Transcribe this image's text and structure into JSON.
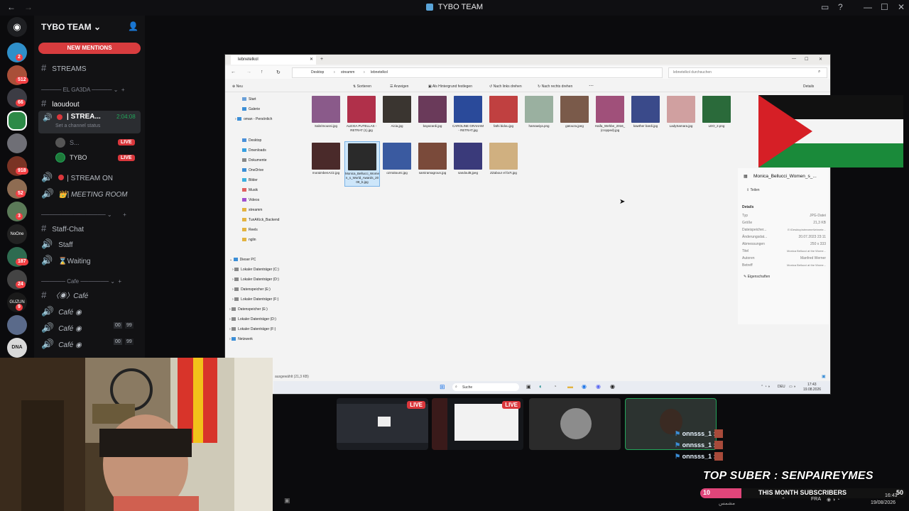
{
  "window": {
    "title": "TYBO TEAM"
  },
  "server": {
    "name": "TYBO TEAM",
    "new_mentions": "NEW MENTIONS",
    "badges": [
      "2",
      "512",
      "66",
      "918",
      "52",
      "3",
      "187",
      "24",
      "9"
    ],
    "rail_labels": [
      "NoOne",
      "GUZUN",
      "DNA"
    ]
  },
  "channels": {
    "streams": "STREAMS",
    "cat_ga3da": "EL GA3DA",
    "laoudout": "laoudout",
    "stream_live": "| STREA...",
    "stream_timer": "2:04:08",
    "channel_status": "Set a channel status",
    "voice_user_1": "S...",
    "voice_user_2": "TYBO",
    "live_label": "LIVE",
    "stream_on": "| STREAM ON",
    "meeting_room": "| MEETING ROOM",
    "staff_chat": "Staff-Chat",
    "staff": "Staff",
    "waiting": "Waiting",
    "cat_cafe": "Cafe",
    "cafe_text": "Café",
    "cafe_voice_1": "Café",
    "cafe_voice_2": "Café",
    "cafe_voice_3": "Café",
    "count_00": "00",
    "count_99": "99"
  },
  "explorer": {
    "tab": "lebnetelkol",
    "breadcrumb": [
      "Desktop",
      "streamm",
      "lebnetelkol"
    ],
    "search_placeholder": "lebnetelkol durchsuchen",
    "toolbar": [
      "Neu",
      "Sortieren",
      "Anzeigen",
      "Als Hintergrund festlegen",
      "Nach links drehen",
      "Nach rechts drehen",
      "Details"
    ],
    "nav": [
      "Start",
      "Galerie",
      "oman - Persönlich",
      "Desktop",
      "Downloads",
      "Dokumente",
      "OneDrive",
      "Bilder",
      "Musik",
      "Videos",
      "streamm",
      "TunAKick_Backend",
      "Reels",
      "nglin",
      "Dieser PC",
      "Lokaler Datenträger (C:)",
      "Lokaler Datenträger (D:)",
      "Datenspeicher (E:)",
      "Lokaler Datenträger (F:)",
      "Datenspeicher (E:)",
      "Lokaler Datenträger (D:)",
      "Lokaler Datenträger (F:)",
      "Netzwerk"
    ],
    "files_row1": [
      "Sabrimoussi.jpg",
      "ALEXIA PUTELLAS - RETRAT (1).jpg",
      "Aicia.jpg",
      "bayazardi.jpg",
      "CAROLINE GRAHAM - RETRAT.jpg",
      "fathi bidou.jpg",
      "hamawiya.png",
      "gatouza.jpeg",
      "Haifa_Wehbe_2016_(cropped).jpg",
      "kawther bardi.jpg",
      "LadySamara.jpg",
      "LEO_2.png"
    ],
    "files_row2": [
      "moraimbenAziz.jpg",
      "Monica_Bellucci_Women_s_World_Awards_2009_b.jpg",
      "ozrraitoumi.jpg",
      "samiramagroun.jpg",
      "sandoul8.jpeg",
      "ZZabour el fa7t.jpg"
    ],
    "details_title": "Monica_Bellucci_Women_s_...",
    "share": "Teilen",
    "details_heading": "Details",
    "detail_keys": [
      "Typ",
      "Größe",
      "Dateispeicher...",
      "Änderungsdat...",
      "Abmessungen",
      "Titel",
      "Autoren",
      "Betreff"
    ],
    "detail_vals": [
      "JPG-Datei",
      "21,3 KB",
      "E:\\Desktop\\streamm\\lebnete...",
      "20.07.2023 23:11",
      "250 x 333",
      "Monica Bellucci at the Wome...",
      "Manfred Werner",
      "Monica Bellucci at the Wome..."
    ],
    "properties": "Eigenschaften",
    "status": "ausgewählt (21,3 KB)",
    "taskbar_search": "Suche",
    "taskbar_lang": "DEU",
    "taskbar_time": "17:43",
    "taskbar_date": "19.08.2026"
  },
  "streams": {
    "live_label": "LIVE",
    "viewers": [
      "onnsss_1 :",
      "onnsss_1 :",
      "onnsss_1 :"
    ]
  },
  "overlay": {
    "top_suber": "TOP SUBER : SENPAIREYMES",
    "sub_count_left": "10",
    "sub_text": "THIS MONTH SUBSCRIBERS",
    "sub_count_right": "50",
    "taskbar_lang": "FRA",
    "taskbar_time": "16:43",
    "taskbar_date": "19/08/2026",
    "taskbar_weather": "مشمس"
  }
}
